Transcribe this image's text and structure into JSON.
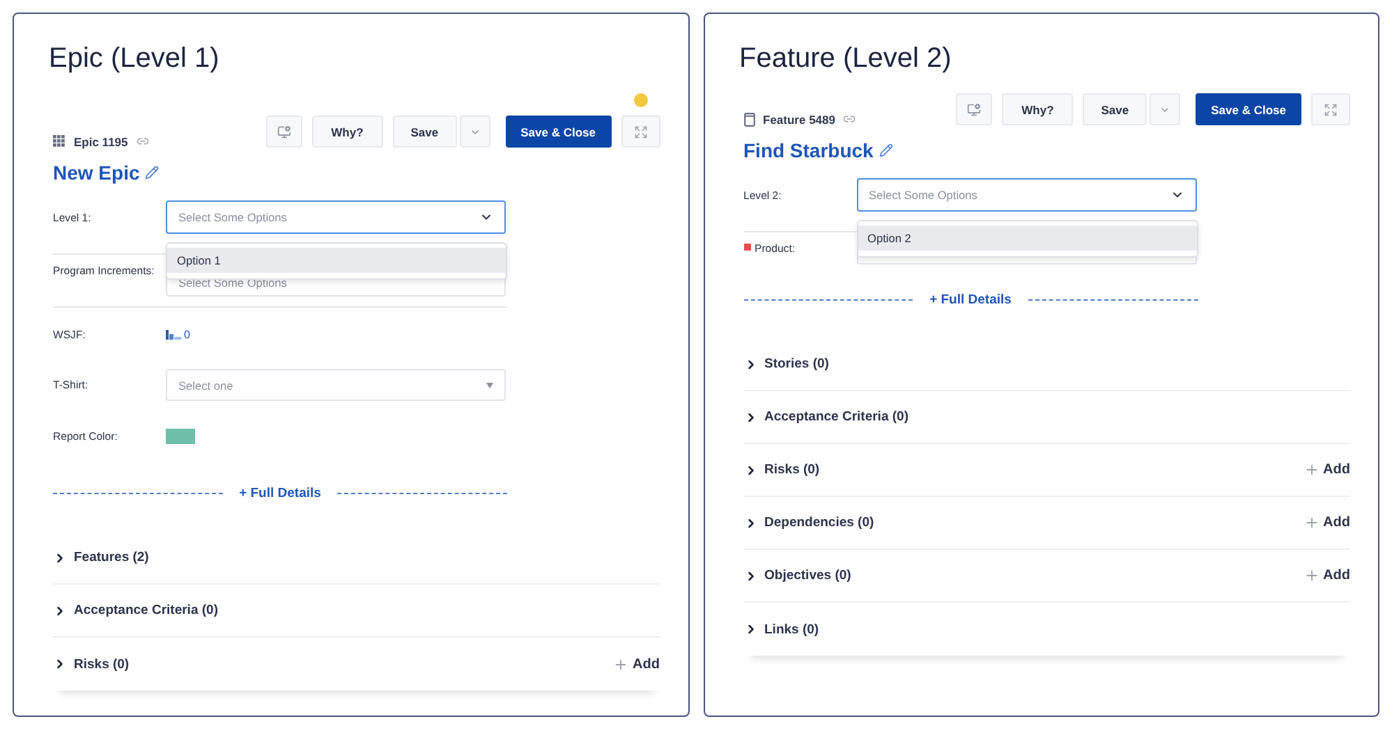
{
  "panels": [
    {
      "title": "Epic (Level 1)",
      "notification_dot": true,
      "toolbar": [
        {
          "kind": "icon"
        },
        {
          "kind": "text",
          "label": "Why?"
        },
        {
          "kind": "split",
          "label": "Save"
        },
        {
          "kind": "primary",
          "label": "Save & Close"
        },
        {
          "kind": "expand"
        }
      ],
      "item": {
        "kind": "epic",
        "id": "Epic 1195",
        "name": "New Epic"
      },
      "fields": [
        {
          "label": "Level 1:",
          "kind": "multiselect",
          "placeholder": "Select Some Options",
          "focused": true,
          "options": [
            {
              "label": "Option 1",
              "selected": true
            }
          ]
        },
        {
          "label": "Program Increments:",
          "kind": "multiselect",
          "placeholder": "Select Some Options",
          "focused": false
        },
        {
          "label": "WSJF:",
          "kind": "score",
          "value": "0"
        },
        {
          "label": "T-Shirt:",
          "kind": "select",
          "placeholder": "Select one"
        },
        {
          "label": "Report Color:",
          "kind": "color",
          "color": "#6dbfa9"
        }
      ],
      "full_details": "+ Full Details",
      "sections": [
        {
          "title": "Features (2)",
          "expanded": false
        },
        {
          "title": "Acceptance Criteria (0)",
          "expanded": false
        },
        {
          "title": "Risks (0)",
          "expanded": false,
          "action": "Add"
        }
      ]
    },
    {
      "title": "Feature (Level 2)",
      "notification_dot": false,
      "toolbar": [
        {
          "kind": "icon"
        },
        {
          "kind": "text",
          "label": "Why?"
        },
        {
          "kind": "split",
          "label": "Save"
        },
        {
          "kind": "primary",
          "label": "Save & Close"
        },
        {
          "kind": "expand"
        }
      ],
      "item": {
        "kind": "feature",
        "id": "Feature 5489",
        "name": "Find Starbuck"
      },
      "fields": [
        {
          "label": "Level 2:",
          "kind": "multiselect",
          "placeholder": "Select Some Options",
          "focused": true,
          "options": [
            {
              "label": "Option 2",
              "selected": true
            }
          ]
        },
        {
          "label": "Product:",
          "kind": "select",
          "required": true
        }
      ],
      "full_details": "+ Full Details",
      "sections": [
        {
          "title": "Stories (0)",
          "expanded": false
        },
        {
          "title": "Acceptance Criteria (0)",
          "expanded": false
        },
        {
          "title": "Risks (0)",
          "expanded": false,
          "action": "Add"
        },
        {
          "title": "Dependencies (0)",
          "expanded": false,
          "action": "Add"
        },
        {
          "title": "Objectives (0)",
          "expanded": false,
          "action": "Add"
        },
        {
          "title": "Links (0)",
          "expanded": false
        }
      ]
    }
  ]
}
